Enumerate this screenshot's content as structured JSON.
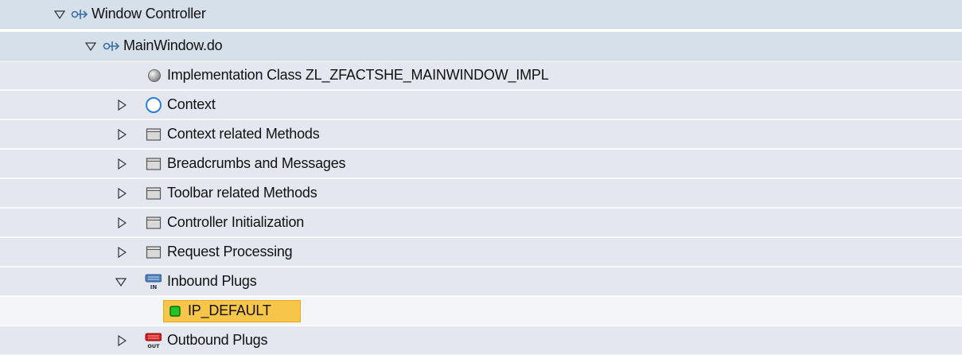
{
  "tree": {
    "window_controller": {
      "label": "Window Controller",
      "icon": "controller-network-icon",
      "expanded": true
    },
    "main_window": {
      "label": "MainWindow.do",
      "icon": "controller-network-icon",
      "expanded": true
    },
    "implementation_class": {
      "label": "Implementation Class ZL_ZFACTSHE_MAINWINDOW_IMPL",
      "icon": "gray-sphere-icon"
    },
    "context": {
      "label": "Context",
      "icon": "blue-circle-icon",
      "expanded": false
    },
    "context_methods": {
      "label": "Context related Methods",
      "icon": "folder-icon",
      "expanded": false
    },
    "breadcrumbs": {
      "label": "Breadcrumbs and Messages",
      "icon": "folder-icon",
      "expanded": false
    },
    "toolbar_methods": {
      "label": "Toolbar related Methods",
      "icon": "folder-icon",
      "expanded": false
    },
    "controller_init": {
      "label": "Controller Initialization",
      "icon": "folder-icon",
      "expanded": false
    },
    "request_processing": {
      "label": "Request Processing",
      "icon": "folder-icon",
      "expanded": false
    },
    "inbound_plugs": {
      "label": "Inbound Plugs",
      "icon": "inbound-plug-icon",
      "icon_text": "IN",
      "expanded": true
    },
    "ip_default": {
      "label": "IP_DEFAULT",
      "icon": "green-square-icon",
      "selected": true
    },
    "outbound_plugs": {
      "label": "Outbound Plugs",
      "icon": "outbound-plug-icon",
      "icon_text": "OUT",
      "expanded": false
    }
  },
  "colors": {
    "header_row": "#d6e0ea",
    "row": "#e4e8ee",
    "selected_row": "#f3f5f8",
    "selection_highlight": "#f7c54a",
    "inbound_plug": "#4f7fb8",
    "outbound_plug": "#d42020",
    "green_status": "#22c322"
  }
}
